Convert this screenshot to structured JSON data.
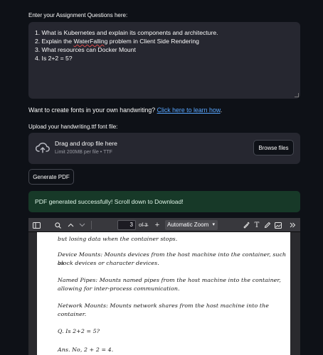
{
  "questions_label": "Enter your Assignment Questions here:",
  "questions_lines": [
    "1. What is Kubernetes and explain its components and architecture.",
    "2. Explain the ",
    "WaterFalling",
    " problem in Client Side Rendering",
    "3. What resources can Docker Mount",
    "4. Is 2+2 = 5?"
  ],
  "fonts_prompt": "Want to create fonts in your own handwriting?",
  "fonts_link": "Click here to learn how",
  "fonts_period": ".",
  "upload_label": "Upload your handwriting.ttf font file:",
  "uploader": {
    "title": "Drag and drop file here",
    "subtitle": "Limit 200MB per file • TTF",
    "browse_label": "Browse files"
  },
  "generate_label": "Generate PDF",
  "success_message": "PDF generated successfully! Scroll down to Download!",
  "viewer": {
    "page_number": "3",
    "of_pages": "of 3",
    "zoom": "Automatic Zoom",
    "zoom_out": "—",
    "zoom_in": "+",
    "pdf_lines": [
      "but losing data when the container stops.",
      "Device Mounts: Mounts devices from the host machine into the container, such as",
      "block devices or character devices.",
      "Named Pipes: Mounts named pipes from the host machine into the container,",
      "allowing for inter-process communication.",
      "Network Mounts: Mounts network shares from the host machine into the container.",
      "Q. Is 2+2 = 5?",
      "Ans. No, 2 + 2 = 4."
    ]
  },
  "colors": {
    "background": "#0e1117",
    "input_bg": "#262730",
    "link": "#58a6ff",
    "success_bg": "#173928",
    "viewer_toolbar": "#38383d"
  }
}
